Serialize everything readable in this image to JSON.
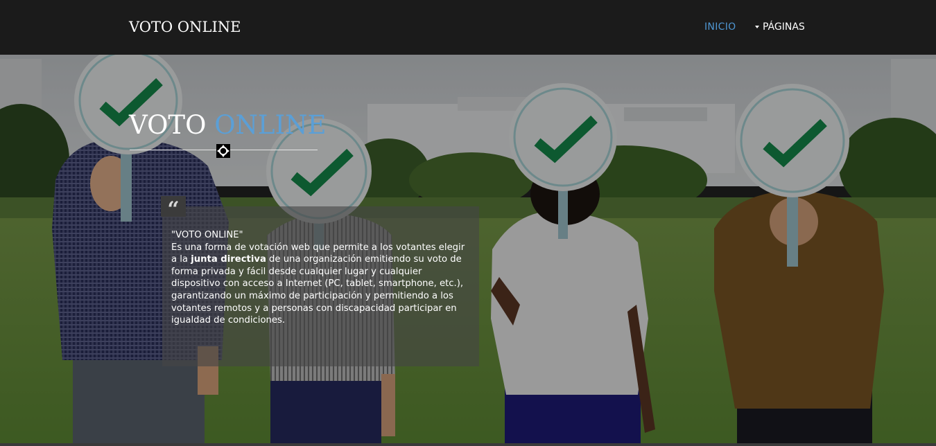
{
  "navbar": {
    "brand": "VOTO ONLINE",
    "links": [
      {
        "label": "INICIO",
        "active": true
      },
      {
        "label": "PÁGINAS",
        "dropdown": true
      }
    ]
  },
  "hero": {
    "title_part1": "VOTO",
    "title_part2": "ONLINE",
    "quote_icon": "quote-left-icon",
    "quote": {
      "heading": "\"VOTO ONLINE\"",
      "text_before": "Es una forma de votación web que permite a los votantes elegir a la ",
      "text_bold": "junta directiva",
      "text_after": " de una organización emitiendo su voto de forma privada y fácil desde cualquier lugar y cualquier dispositivo con acceso a Internet (PC, tablet, smartphone, etc.), garantizando un máximo de participación y permitiendo a los votantes remotos y a personas con discapacidad participar en igualdad de condiciones."
    }
  },
  "colors": {
    "navbar_bg": "#1b1b1b",
    "accent": "#5b9fd6",
    "nav_active": "#4f97d3",
    "check_green": "#14894a"
  }
}
